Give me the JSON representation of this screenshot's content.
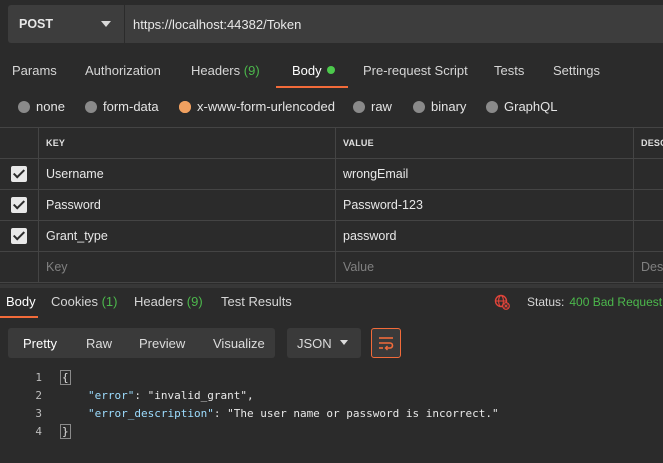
{
  "request": {
    "method": "POST",
    "url": "https://localhost:44382/Token"
  },
  "request_tabs": [
    {
      "label": "Params"
    },
    {
      "label": "Authorization"
    },
    {
      "label": "Headers",
      "count": "(9)"
    },
    {
      "label": "Body",
      "active": true
    },
    {
      "label": "Pre-request Script"
    },
    {
      "label": "Tests"
    },
    {
      "label": "Settings"
    }
  ],
  "body_types": [
    {
      "label": "none"
    },
    {
      "label": "form-data"
    },
    {
      "label": "x-www-form-urlencoded",
      "selected": true
    },
    {
      "label": "raw"
    },
    {
      "label": "binary"
    },
    {
      "label": "GraphQL"
    }
  ],
  "params_table": {
    "columns": [
      "KEY",
      "VALUE",
      "DESCR"
    ],
    "rows": [
      {
        "checked": true,
        "key": "Username",
        "value": "wrongEmail"
      },
      {
        "checked": true,
        "key": "Password",
        "value": "Password-123"
      },
      {
        "checked": true,
        "key": "Grant_type",
        "value": "password"
      }
    ],
    "placeholder": {
      "key": "Key",
      "value": "Value",
      "description": "Des"
    }
  },
  "response_tabs": [
    {
      "label": "Body",
      "active": true
    },
    {
      "label": "Cookies",
      "count": "(1)"
    },
    {
      "label": "Headers",
      "count": "(9)"
    },
    {
      "label": "Test Results"
    }
  ],
  "status": {
    "label": "Status:",
    "value": "400 Bad Request"
  },
  "view_modes": [
    "Pretty",
    "Raw",
    "Preview",
    "Visualize"
  ],
  "format_select": "JSON",
  "code_lines": [
    {
      "n": "1",
      "text": "{"
    },
    {
      "n": "2",
      "key": "\"error\"",
      "value": "\"invalid_grant\","
    },
    {
      "n": "3",
      "key": "\"error_description\"",
      "value": "\"The user name or password is incorrect.\""
    },
    {
      "n": "4",
      "text": "}"
    }
  ],
  "colors": {
    "accent": "#f26b3a",
    "success": "#4cb84c",
    "background": "#2b2b2b"
  }
}
